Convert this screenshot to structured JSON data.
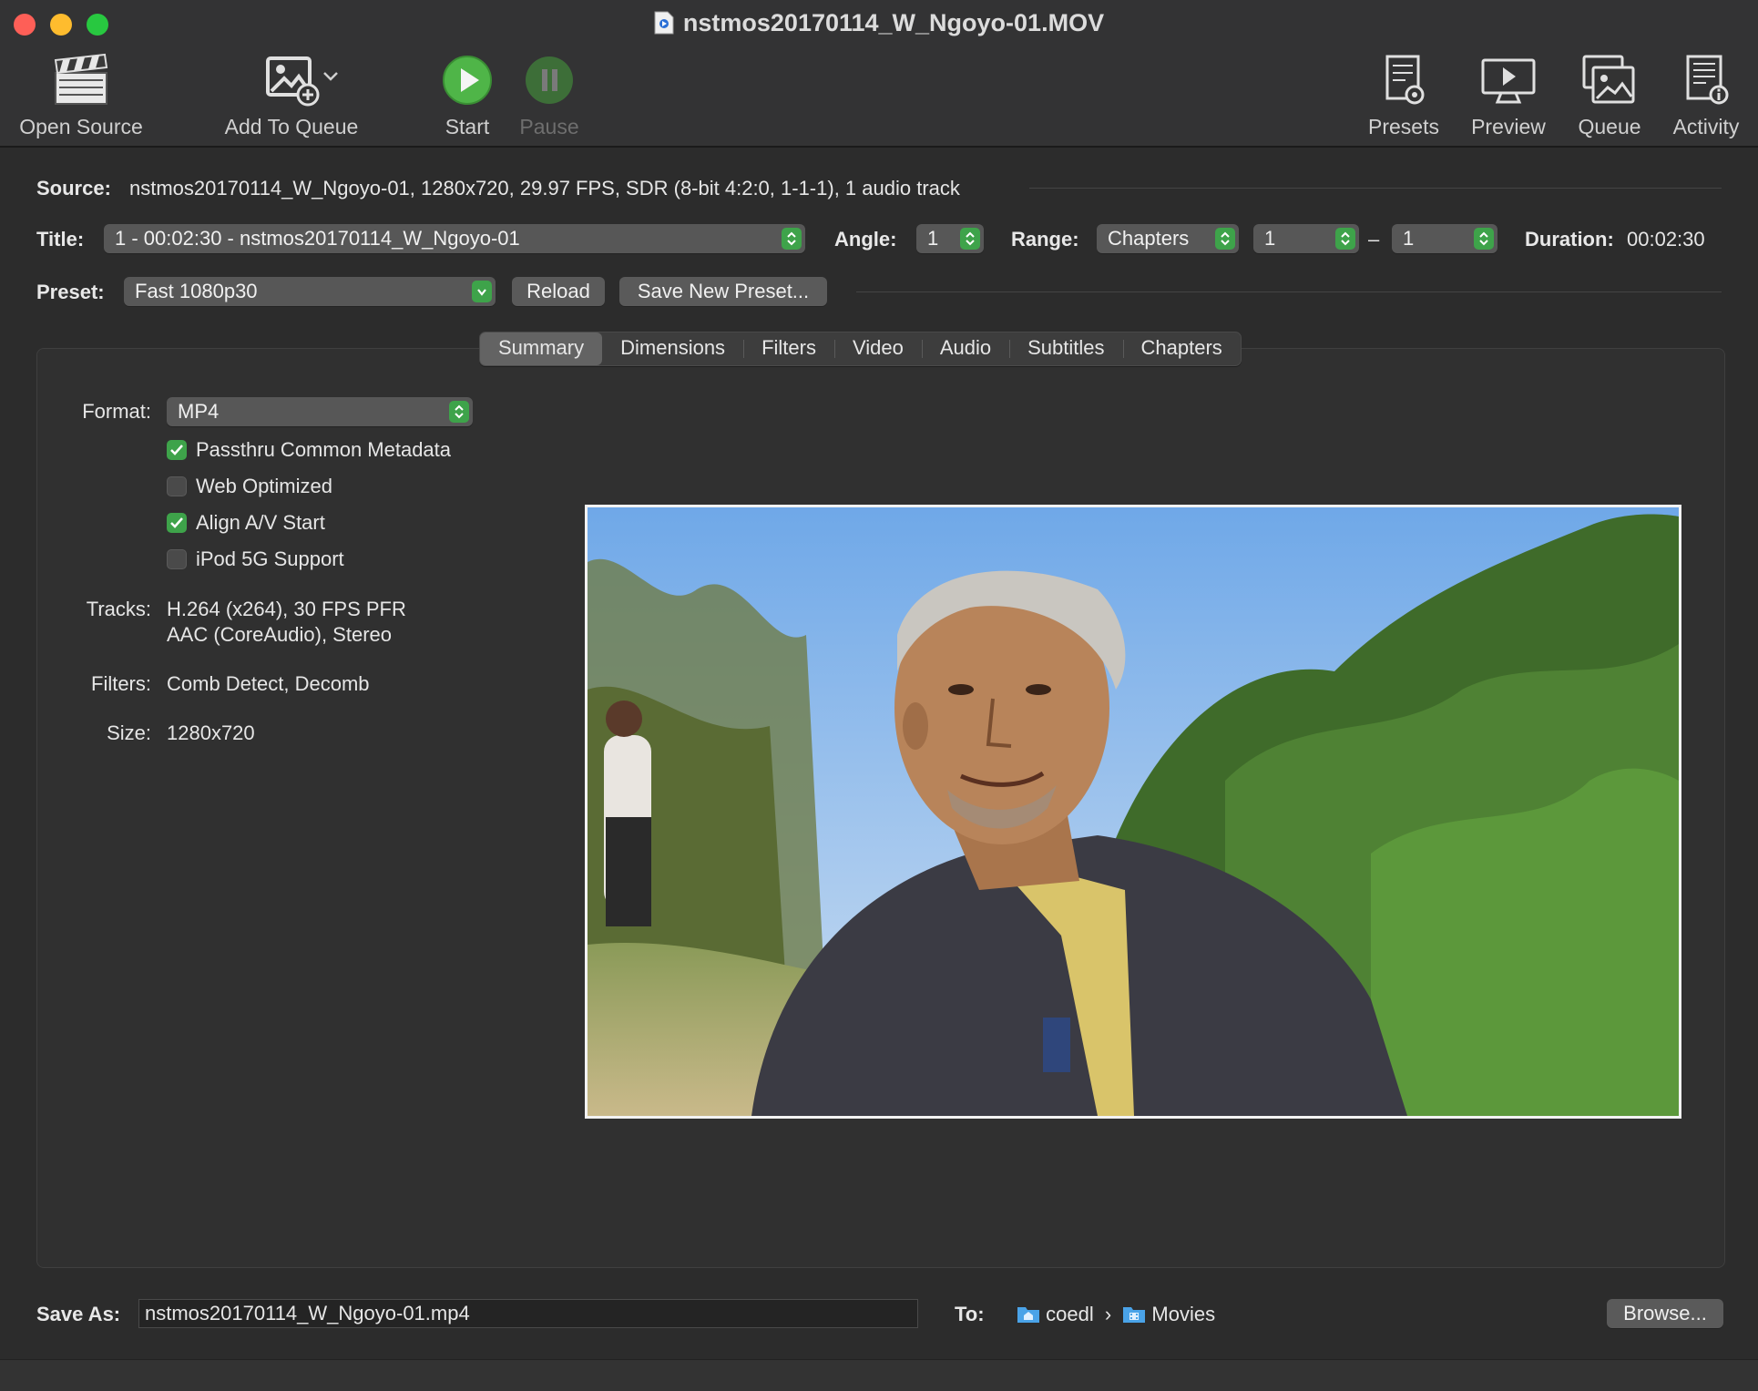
{
  "window": {
    "title": "nstmos20170114_W_Ngoyo-01.MOV"
  },
  "toolbar": {
    "open_source": "Open Source",
    "add_to_queue": "Add To Queue",
    "start": "Start",
    "pause": "Pause",
    "presets": "Presets",
    "preview": "Preview",
    "queue": "Queue",
    "activity": "Activity"
  },
  "source": {
    "label": "Source:",
    "value": "nstmos20170114_W_Ngoyo-01, 1280x720, 29.97 FPS, SDR (8-bit 4:2:0, 1-1-1), 1 audio track"
  },
  "title_row": {
    "label": "Title:",
    "value": "1 - 00:02:30 - nstmos20170114_W_Ngoyo-01",
    "angle_label": "Angle:",
    "angle_value": "1",
    "range_label": "Range:",
    "range_type": "Chapters",
    "range_start": "1",
    "range_dash": "–",
    "range_end": "1",
    "duration_label": "Duration:",
    "duration_value": "00:02:30"
  },
  "preset_row": {
    "label": "Preset:",
    "value": "Fast 1080p30",
    "reload": "Reload",
    "save_new": "Save New Preset..."
  },
  "tabs": [
    "Summary",
    "Dimensions",
    "Filters",
    "Video",
    "Audio",
    "Subtitles",
    "Chapters"
  ],
  "summary": {
    "format_label": "Format:",
    "format_value": "MP4",
    "checkboxes": [
      {
        "label": "Passthru Common Metadata",
        "checked": true
      },
      {
        "label": "Web Optimized",
        "checked": false
      },
      {
        "label": "Align A/V Start",
        "checked": true
      },
      {
        "label": "iPod 5G Support",
        "checked": false
      }
    ],
    "tracks_label": "Tracks:",
    "tracks_line1": "H.264 (x264), 30 FPS PFR",
    "tracks_line2": "AAC (CoreAudio), Stereo",
    "filters_label": "Filters:",
    "filters_value": "Comb Detect, Decomb",
    "size_label": "Size:",
    "size_value": "1280x720"
  },
  "save_as": {
    "label": "Save As:",
    "value": "nstmos20170114_W_Ngoyo-01.mp4",
    "to_label": "To:",
    "folder1": "coedl",
    "chevron": "›",
    "folder2": "Movies",
    "browse": "Browse..."
  },
  "colors": {
    "accent_green": "#3ea34a",
    "background": "#2c2c2c"
  }
}
